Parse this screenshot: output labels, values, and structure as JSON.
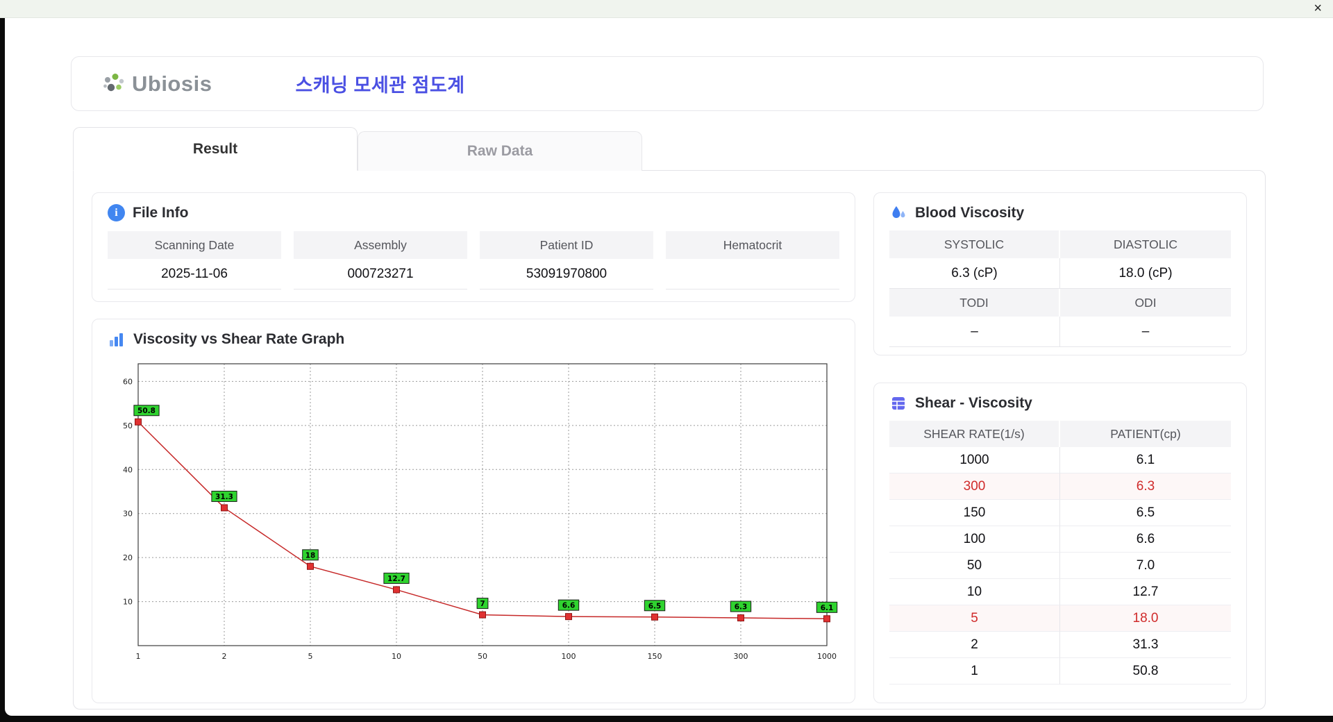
{
  "window": {
    "close_icon": "×"
  },
  "header": {
    "brand": "Ubiosis",
    "title": "스캐닝 모세관 점도계"
  },
  "tabs": [
    {
      "label": "Result",
      "active": true
    },
    {
      "label": "Raw Data",
      "active": false
    }
  ],
  "file_info": {
    "title": "File Info",
    "fields": [
      {
        "label": "Scanning Date",
        "value": "2025-11-06"
      },
      {
        "label": "Assembly",
        "value": "000723271"
      },
      {
        "label": "Patient ID",
        "value": "53091970800"
      },
      {
        "label": "Hematocrit",
        "value": ""
      }
    ]
  },
  "blood_viscosity": {
    "title": "Blood Viscosity",
    "cells": [
      {
        "label": "SYSTOLIC",
        "value": "6.3 (cP)"
      },
      {
        "label": "DIASTOLIC",
        "value": "18.0 (cP)"
      },
      {
        "label": "TODI",
        "value": "–"
      },
      {
        "label": "ODI",
        "value": "–"
      }
    ]
  },
  "shear_viscosity": {
    "title": "Shear - Viscosity",
    "columns": [
      "SHEAR RATE(1/s)",
      "PATIENT(cp)"
    ],
    "rows": [
      {
        "shear_rate": "1000",
        "patient": "6.1",
        "highlight": false
      },
      {
        "shear_rate": "300",
        "patient": "6.3",
        "highlight": true
      },
      {
        "shear_rate": "150",
        "patient": "6.5",
        "highlight": false
      },
      {
        "shear_rate": "100",
        "patient": "6.6",
        "highlight": false
      },
      {
        "shear_rate": "50",
        "patient": "7.0",
        "highlight": false
      },
      {
        "shear_rate": "10",
        "patient": "12.7",
        "highlight": false
      },
      {
        "shear_rate": "5",
        "patient": "18.0",
        "highlight": true
      },
      {
        "shear_rate": "2",
        "patient": "31.3",
        "highlight": false
      },
      {
        "shear_rate": "1",
        "patient": "50.8",
        "highlight": false
      }
    ]
  },
  "chart_data": {
    "type": "line",
    "title": "Viscosity vs Shear Rate Graph",
    "x": [
      "1",
      "2",
      "5",
      "10",
      "50",
      "100",
      "150",
      "300",
      "1000"
    ],
    "x_scale": "categorical",
    "xlabel": "",
    "ylabel": "",
    "values": [
      50.8,
      31.3,
      18,
      12.7,
      7,
      6.6,
      6.5,
      6.3,
      6.1
    ],
    "point_labels": [
      "50.8",
      "31.3",
      "18",
      "12.7",
      "7",
      "6.6",
      "6.5",
      "6.3",
      "6.1"
    ],
    "yticks": [
      10,
      20,
      30,
      40,
      50,
      60
    ],
    "ylim": [
      0,
      64
    ],
    "grid": true,
    "legend": false,
    "line_color": "#c62828",
    "marker_color": "#e03131",
    "label_bg": "#2fd32f"
  }
}
